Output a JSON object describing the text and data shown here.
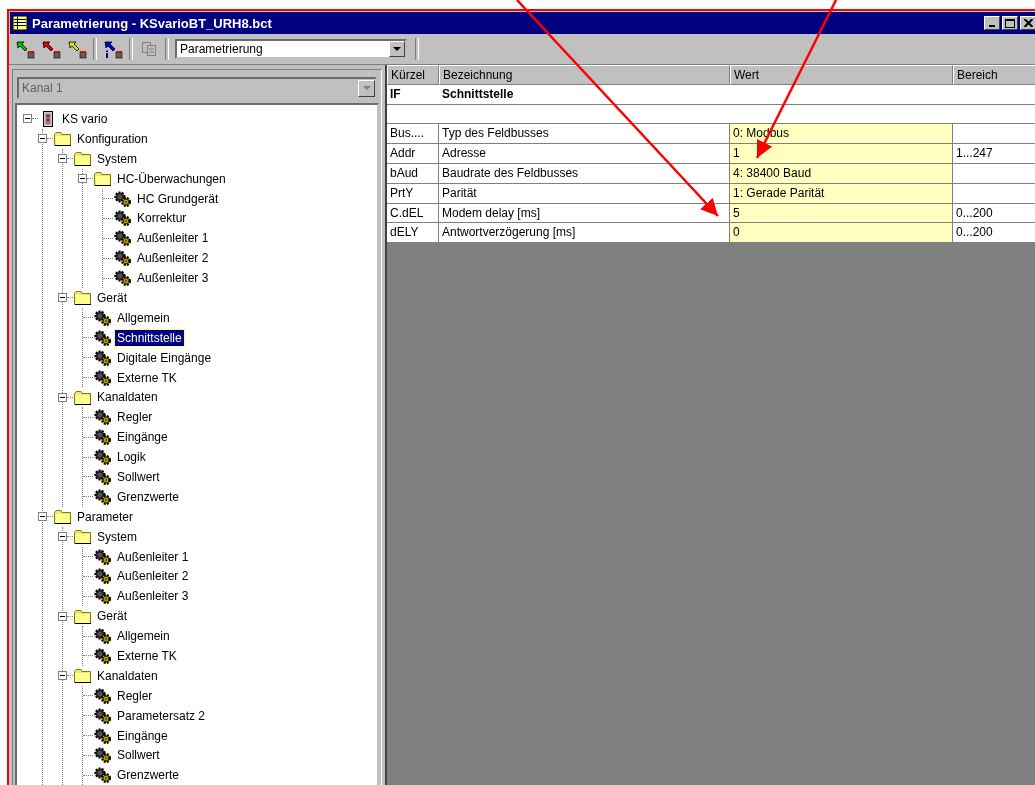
{
  "window": {
    "title": "Parametrierung - KSvarioBT_URH8.bct"
  },
  "toolbar": {
    "view_select": {
      "value": "Parametrierung"
    }
  },
  "channel_select": {
    "value": "Kanal 1",
    "disabled": true
  },
  "tree": [
    {
      "label": "KS vario",
      "kind": "device",
      "expanded": true,
      "selected": false,
      "children": [
        {
          "label": "Konfiguration",
          "kind": "folder",
          "expanded": true,
          "selected": false,
          "children": [
            {
              "label": "System",
              "kind": "folder",
              "expanded": true,
              "selected": false,
              "children": [
                {
                  "label": "HC-Überwachungen",
                  "kind": "folder",
                  "expanded": true,
                  "selected": false,
                  "children": [
                    {
                      "label": "HC Grundgerät",
                      "kind": "item",
                      "selected": false
                    },
                    {
                      "label": "Korrektur",
                      "kind": "item",
                      "selected": false
                    },
                    {
                      "label": "Außenleiter 1",
                      "kind": "item",
                      "selected": false
                    },
                    {
                      "label": "Außenleiter 2",
                      "kind": "item",
                      "selected": false
                    },
                    {
                      "label": "Außenleiter 3",
                      "kind": "item",
                      "selected": false
                    }
                  ]
                }
              ]
            },
            {
              "label": "Gerät",
              "kind": "folder",
              "expanded": true,
              "selected": false,
              "children": [
                {
                  "label": "Allgemein",
                  "kind": "item",
                  "selected": false
                },
                {
                  "label": "Schnittstelle",
                  "kind": "item",
                  "selected": true
                },
                {
                  "label": "Digitale Eingänge",
                  "kind": "item",
                  "selected": false
                },
                {
                  "label": "Externe TK",
                  "kind": "item",
                  "selected": false
                }
              ]
            },
            {
              "label": "Kanaldaten",
              "kind": "folder",
              "expanded": true,
              "selected": false,
              "children": [
                {
                  "label": "Regler",
                  "kind": "item",
                  "selected": false
                },
                {
                  "label": "Eingänge",
                  "kind": "item",
                  "selected": false
                },
                {
                  "label": "Logik",
                  "kind": "item",
                  "selected": false
                },
                {
                  "label": "Sollwert",
                  "kind": "item",
                  "selected": false
                },
                {
                  "label": "Grenzwerte",
                  "kind": "item",
                  "selected": false
                }
              ]
            }
          ]
        },
        {
          "label": "Parameter",
          "kind": "folder",
          "expanded": true,
          "selected": false,
          "children": [
            {
              "label": "System",
              "kind": "folder",
              "expanded": true,
              "selected": false,
              "children": [
                {
                  "label": "Außenleiter 1",
                  "kind": "item",
                  "selected": false
                },
                {
                  "label": "Außenleiter 2",
                  "kind": "item",
                  "selected": false
                },
                {
                  "label": "Außenleiter 3",
                  "kind": "item",
                  "selected": false
                }
              ]
            },
            {
              "label": "Gerät",
              "kind": "folder",
              "expanded": true,
              "selected": false,
              "children": [
                {
                  "label": "Allgemein",
                  "kind": "item",
                  "selected": false
                },
                {
                  "label": "Externe TK",
                  "kind": "item",
                  "selected": false
                }
              ]
            },
            {
              "label": "Kanaldaten",
              "kind": "folder",
              "expanded": true,
              "selected": false,
              "children": [
                {
                  "label": "Regler",
                  "kind": "item",
                  "selected": false
                },
                {
                  "label": "Parametersatz 2",
                  "kind": "item",
                  "selected": false
                },
                {
                  "label": "Eingänge",
                  "kind": "item",
                  "selected": false
                },
                {
                  "label": "Sollwert",
                  "kind": "item",
                  "selected": false
                },
                {
                  "label": "Grenzwerte",
                  "kind": "item",
                  "selected": false
                }
              ]
            }
          ]
        }
      ]
    }
  ],
  "table": {
    "columns": [
      "Kürzel",
      "Bezeichnung",
      "Wert",
      "Bereich"
    ],
    "section": {
      "code": "IF",
      "name": "Schnittstelle"
    },
    "rows": [
      {
        "code": "Bus....",
        "name": "Typ des Feldbusses",
        "value": "0: Modbus"
      },
      {
        "code": "Addr",
        "name": "Adresse",
        "value": "1",
        "range": "1...247"
      },
      {
        "code": "bAud",
        "name": "Baudrate des Feldbusses",
        "value": "4: 38400 Baud"
      },
      {
        "code": "PrtY",
        "name": "Parität",
        "value": "1: Gerade Parität"
      },
      {
        "code": "C.dEL",
        "name": "Modem delay [ms]",
        "value": "5",
        "range": "0...200"
      },
      {
        "code": "dELY",
        "name": "Antwortverzögerung [ms]",
        "value": "0",
        "range": "0...200"
      }
    ]
  }
}
